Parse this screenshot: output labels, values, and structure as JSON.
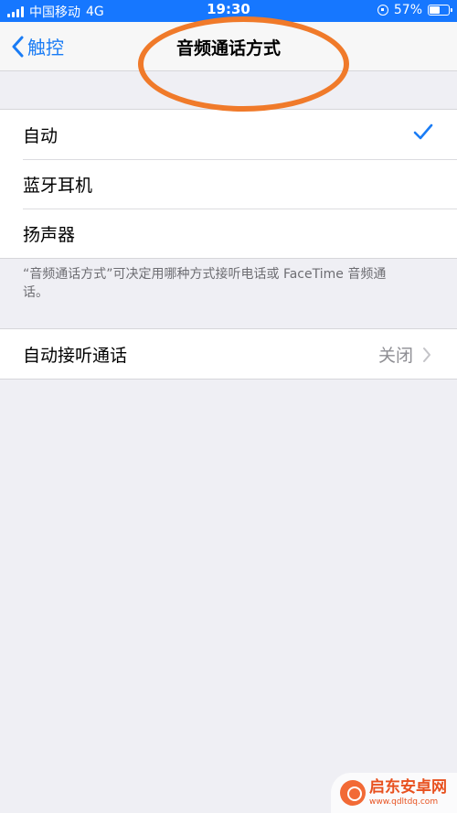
{
  "status_bar": {
    "carrier": "中国移动",
    "network": "4G",
    "time": "19:30",
    "battery": "57%",
    "battery_level": 0.57
  },
  "nav": {
    "back_label": "触控",
    "title": "音频通话方式"
  },
  "routing_options": [
    {
      "label": "自动",
      "selected": true
    },
    {
      "label": "蓝牙耳机",
      "selected": false
    },
    {
      "label": "扬声器",
      "selected": false
    }
  ],
  "footer_note": "“音频通话方式”可决定用哪种方式接听电话或 FaceTime 音频通话。",
  "auto_answer": {
    "label": "自动接听通话",
    "value": "关闭"
  },
  "watermark": {
    "title": "启东安卓网",
    "url": "www.qdltdq.com"
  },
  "colors": {
    "accent": "#1a7cf5",
    "annotation": "#f07a2a",
    "status_bar": "#1677ff"
  }
}
